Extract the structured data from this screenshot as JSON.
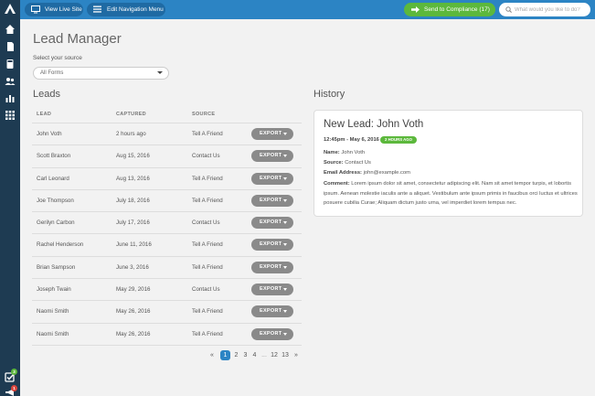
{
  "topbar": {
    "view_site_label": "View Live Site",
    "edit_nav_label": "Edit Navigation Menu",
    "compliance_label": "Send to Compliance (17)",
    "search_placeholder": "What would you like to do?"
  },
  "sidebar": {
    "tasks_badge": "3",
    "alerts_badge": "1"
  },
  "page": {
    "title": "Lead Manager",
    "source_label": "Select your source",
    "source_selected": "All Forms"
  },
  "leads": {
    "heading": "Leads",
    "columns": [
      "LEAD",
      "CAPTURED",
      "SOURCE"
    ],
    "export_label": "EXPORT",
    "rows": [
      {
        "lead": "John Voth",
        "captured": "2 hours ago",
        "source": "Tell A Friend"
      },
      {
        "lead": "Scott Braxton",
        "captured": "Aug 15, 2016",
        "source": "Contact Us"
      },
      {
        "lead": "Carl Leonard",
        "captured": "Aug 13, 2016",
        "source": "Tell A Friend"
      },
      {
        "lead": "Joe Thompson",
        "captured": "July 18, 2016",
        "source": "Tell A Friend"
      },
      {
        "lead": "Gerilyn Carbon",
        "captured": "July 17, 2016",
        "source": "Contact Us"
      },
      {
        "lead": "Rachel Henderson",
        "captured": "June 11, 2016",
        "source": "Tell A Friend"
      },
      {
        "lead": "Brian Sampson",
        "captured": "June 3, 2016",
        "source": "Tell A Friend"
      },
      {
        "lead": "Joseph Twain",
        "captured": "May 29, 2016",
        "source": "Contact Us"
      },
      {
        "lead": "Naomi Smith",
        "captured": "May 26, 2016",
        "source": "Tell A Friend"
      },
      {
        "lead": "Naomi Smith",
        "captured": "May 26, 2016",
        "source": "Tell A Friend"
      }
    ]
  },
  "pagination": {
    "prev": "«",
    "pages": [
      "1",
      "2",
      "3",
      "4"
    ],
    "ellipsis": "...",
    "tail_pages": [
      "12",
      "13"
    ],
    "next": "»",
    "current": "1"
  },
  "history": {
    "heading": "History",
    "title": "New Lead: John Voth",
    "time": "12:45pm - May 6, 2016",
    "badge": "2 HOURS AGO",
    "name_label": "Name:",
    "name_value": "John Voth",
    "source_label": "Source:",
    "source_value": "Contact Us",
    "email_label": "Email Address:",
    "email_value": "john@example.com",
    "comment_label": "Comment:",
    "comment_value": "Lorem ipsum dolor sit amet, consectetur adipiscing elit. Nam sit amet tempor turpis, et lobortis ipsum. Aenean molestie iaculis ante a aliquet. Vestibulum ante ipsum primis in faucibus orci luctus et ultrices posuere cubilia Curae; Aliquam dictum justo urna, vel imperdiet lorem tempus nec."
  },
  "colors": {
    "sidebar": "#1e3b52",
    "topbar": "#2c84c4",
    "accent_green": "#5cb83c",
    "export_gray": "#8a8a8a"
  }
}
